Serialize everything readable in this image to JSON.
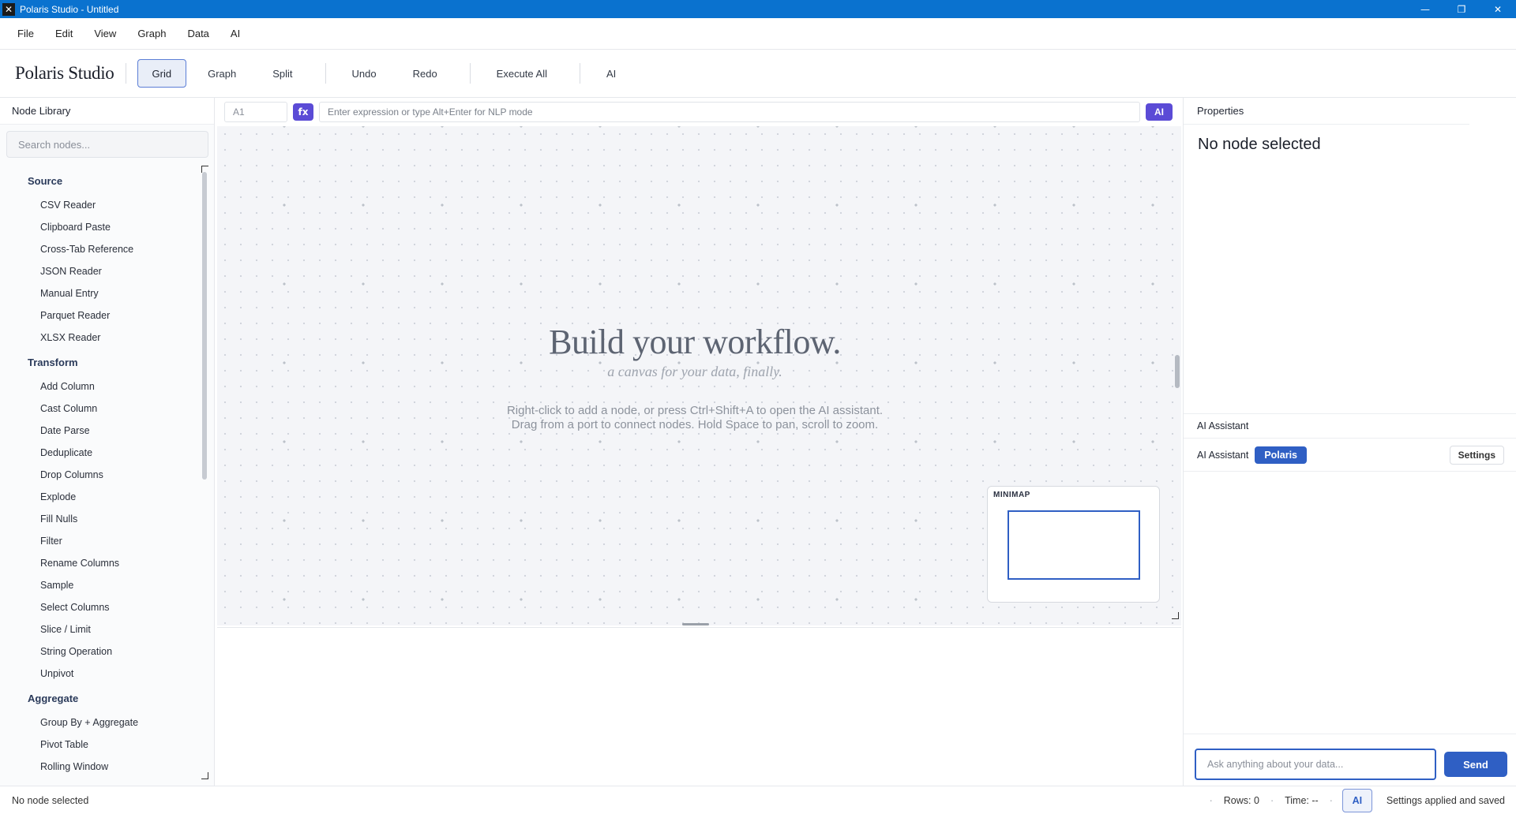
{
  "window": {
    "title": "Polaris Studio - Untitled",
    "controls": {
      "minimize": "—",
      "maximize": "❐",
      "close": "✕"
    }
  },
  "menu": [
    "File",
    "Edit",
    "View",
    "Graph",
    "Data",
    "AI"
  ],
  "toolbar": {
    "brand": "Polaris Studio",
    "view_buttons": [
      "Grid",
      "Graph",
      "Split"
    ],
    "active_view": "Grid",
    "undo": "Undo",
    "redo": "Redo",
    "execute_all": "Execute All",
    "ai": "AI"
  },
  "node_library": {
    "title": "Node Library",
    "search_placeholder": "Search nodes...",
    "categories": [
      {
        "name": "Source",
        "items": [
          "CSV Reader",
          "Clipboard Paste",
          "Cross-Tab Reference",
          "JSON Reader",
          "Manual Entry",
          "Parquet Reader",
          "XLSX Reader"
        ]
      },
      {
        "name": "Transform",
        "items": [
          "Add Column",
          "Cast Column",
          "Date Parse",
          "Deduplicate",
          "Drop Columns",
          "Explode",
          "Fill Nulls",
          "Filter",
          "Rename Columns",
          "Sample",
          "Select Columns",
          "Slice / Limit",
          "String Operation",
          "Unpivot"
        ]
      },
      {
        "name": "Aggregate",
        "items": [
          "Group By + Aggregate",
          "Pivot Table",
          "Rolling Window"
        ]
      }
    ]
  },
  "formula_bar": {
    "cell_ref": "A1",
    "fx_label": "fx",
    "placeholder": "Enter expression or type Alt+Enter for NLP mode",
    "ai_label": "AI"
  },
  "canvas": {
    "title": "Build your workflow.",
    "subtitle": "a canvas for your data, finally.",
    "help_line1": "Right-click to add a node, or press Ctrl+Shift+A to open the AI assistant.",
    "help_line2": "Drag from a port to connect nodes. Hold Space to pan, scroll to zoom.",
    "minimap_label": "MINIMAP"
  },
  "properties": {
    "title": "Properties",
    "empty_message": "No node selected"
  },
  "ai_assistant": {
    "section_title": "AI Assistant",
    "label": "AI Assistant",
    "model": "Polaris",
    "settings": "Settings",
    "input_placeholder": "Ask anything about your data...",
    "send": "Send"
  },
  "status": {
    "left": "No node selected",
    "rows": "Rows: 0",
    "time": "Time: --",
    "ai": "AI",
    "message": "Settings applied and saved"
  },
  "colors": {
    "titlebar": "#0a72cf",
    "accent": "#2f5fc4",
    "fx_purple": "#5b4bd6"
  }
}
